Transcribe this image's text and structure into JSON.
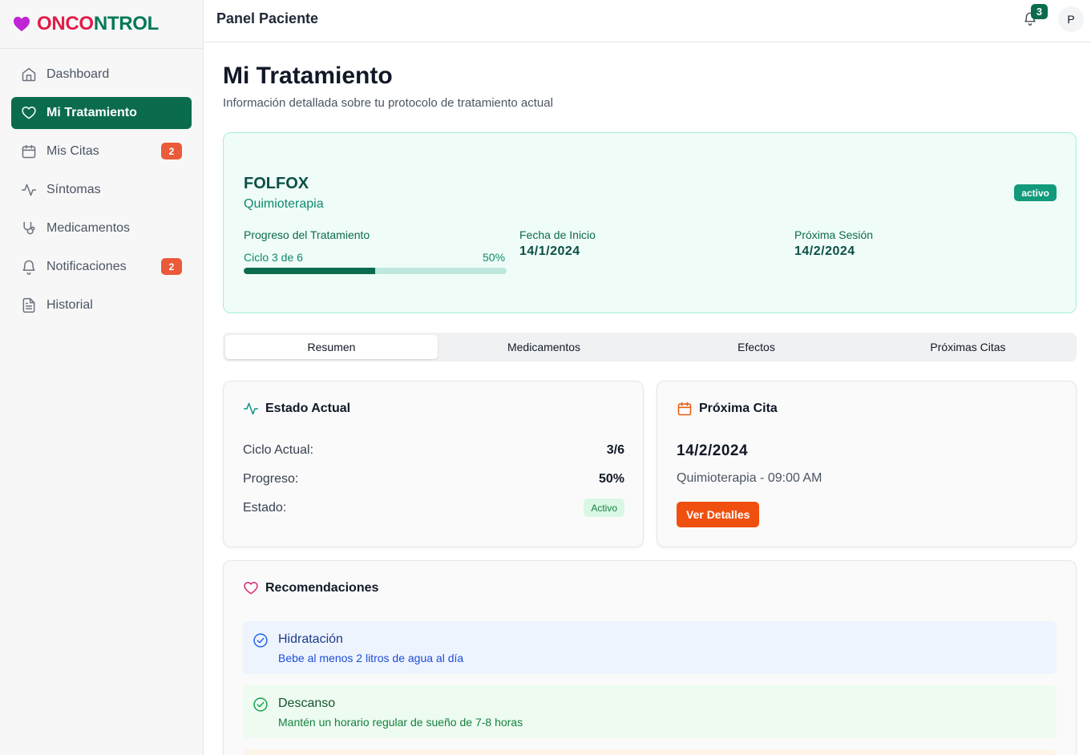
{
  "brand": {
    "part1": "ONCO",
    "part2": "NTROL",
    "colors": {
      "primary": "#e11d48",
      "secondary": "#047857"
    }
  },
  "sidebar": {
    "items": [
      {
        "label": "Dashboard",
        "icon": "home-icon",
        "active": false
      },
      {
        "label": "Mi Tratamiento",
        "icon": "heart-icon",
        "active": true
      },
      {
        "label": "Mis Citas",
        "icon": "calendar-icon",
        "badge": "2"
      },
      {
        "label": "Síntomas",
        "icon": "activity-icon"
      },
      {
        "label": "Medicamentos",
        "icon": "stethoscope-icon"
      },
      {
        "label": "Notificaciones",
        "icon": "bell-icon",
        "badge": "2"
      },
      {
        "label": "Historial",
        "icon": "file-text-icon"
      }
    ]
  },
  "header": {
    "title": "Panel Paciente",
    "notifications_count": "3",
    "avatar_initial": "P"
  },
  "main": {
    "title": "Mi Tratamiento",
    "subtitle": "Información detallada sobre tu protocolo de tratamiento actual",
    "treatment": {
      "name": "FOLFOX",
      "type": "Quimioterapia",
      "status": "activo",
      "progress_label": "Progreso del Tratamiento",
      "cycle_text": "Ciclo 3 de 6",
      "progress_text": "50%",
      "progress_fraction": 0.5,
      "start_label": "Fecha de Inicio",
      "start_date": "14/1/2024",
      "next_label": "Próxima Sesión",
      "next_date": "14/2/2024"
    },
    "tabs": [
      {
        "label": "Resumen",
        "active": true
      },
      {
        "label": "Medicamentos",
        "active": false
      },
      {
        "label": "Efectos",
        "active": false
      },
      {
        "label": "Próximas Citas",
        "active": false
      }
    ],
    "estado_card": {
      "title": "Estado Actual",
      "rows": [
        {
          "label": "Ciclo Actual:",
          "value": "3/6"
        },
        {
          "label": "Progreso:",
          "value": "50%"
        },
        {
          "label": "Estado:",
          "value": "Activo"
        }
      ]
    },
    "cita_card": {
      "title": "Próxima Cita",
      "date": "14/2/2024",
      "description": "Quimioterapia - 09:00 AM",
      "button": "Ver Detalles"
    },
    "recomendaciones": {
      "title": "Recomendaciones",
      "items": [
        {
          "title": "Hidratación",
          "description": "Bebe al menos 2 litros de agua al día",
          "color": "blue"
        },
        {
          "title": "Descanso",
          "description": "Mantén un horario regular de sueño de 7-8 horas",
          "color": "green"
        }
      ]
    }
  },
  "colors": {
    "accent": "#0b6b4f",
    "badge": "#ea5b3a",
    "action": "#f0500f"
  }
}
